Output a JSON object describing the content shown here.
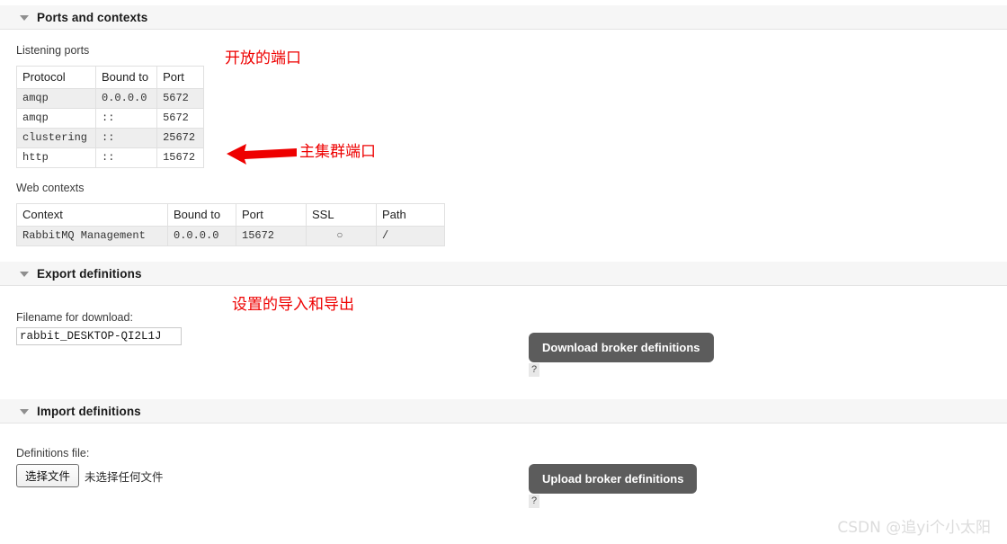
{
  "sections": {
    "ports": {
      "title": "Ports and contexts",
      "collapse_icon": "triangle-down-icon"
    },
    "export": {
      "title": "Export definitions",
      "collapse_icon": "triangle-down-icon"
    },
    "import": {
      "title": "Import definitions",
      "collapse_icon": "triangle-down-icon"
    }
  },
  "listening_ports": {
    "caption": "Listening ports",
    "columns": [
      "Protocol",
      "Bound to",
      "Port"
    ],
    "rows": [
      [
        "amqp",
        "0.0.0.0",
        "5672"
      ],
      [
        "amqp",
        "::",
        "5672"
      ],
      [
        "clustering",
        "::",
        "25672"
      ],
      [
        "http",
        "::",
        "15672"
      ]
    ]
  },
  "web_contexts": {
    "caption": "Web contexts",
    "columns": [
      "Context",
      "Bound to",
      "Port",
      "SSL",
      "Path"
    ],
    "rows": [
      [
        "RabbitMQ Management",
        "0.0.0.0",
        "15672",
        "○",
        "/"
      ]
    ]
  },
  "export_form": {
    "filename_label": "Filename for download:",
    "filename_value": "rabbit_DESKTOP-QI2L1J",
    "download_button": "Download broker definitions",
    "help_label": "?"
  },
  "import_form": {
    "definitions_label": "Definitions file:",
    "choose_file_button": "选择文件",
    "no_file_text": "未选择任何文件",
    "upload_button": "Upload broker definitions",
    "help_label": "?"
  },
  "annotations": {
    "open_ports": "开放的端口",
    "cluster_port": "主集群端口",
    "import_export": "设置的导入和导出",
    "arrow_icon": "left-arrow-icon",
    "color": "#ee0000"
  },
  "watermark": {
    "text": "CSDN @追yi个小太阳"
  }
}
